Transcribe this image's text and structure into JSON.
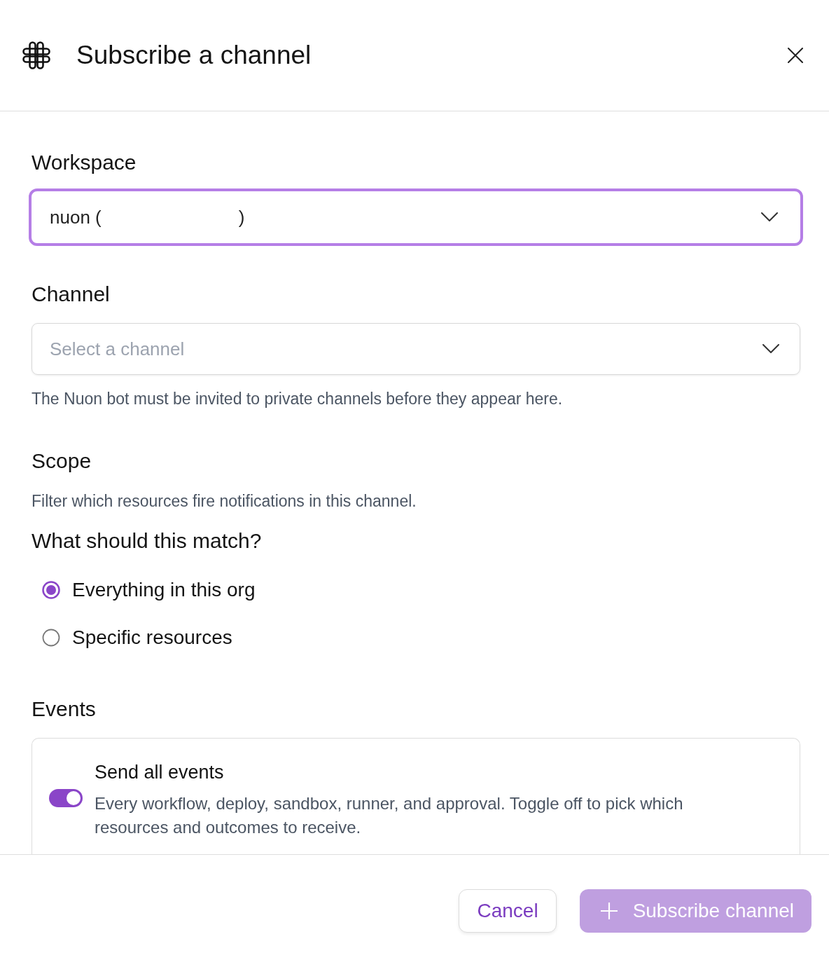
{
  "dialog": {
    "title": "Subscribe a channel"
  },
  "workspace": {
    "label": "Workspace",
    "value_parts": [
      "nuon (",
      ")"
    ],
    "focused": true
  },
  "channel": {
    "label": "Channel",
    "placeholder": "Select a channel",
    "help": "The Nuon bot must be invited to private channels before they appear here."
  },
  "scope": {
    "heading": "Scope",
    "description": "Filter which resources fire notifications in this channel.",
    "question": "What should this match?",
    "options": [
      {
        "label": "Everything in this org",
        "selected": true
      },
      {
        "label": "Specific resources",
        "selected": false
      }
    ]
  },
  "events": {
    "heading": "Events",
    "toggle": {
      "title": "Send all events",
      "description": "Every workflow, deploy, sandbox, runner, and approval. Toggle off to pick which resources and outcomes to receive.",
      "on": true
    }
  },
  "footer": {
    "buttons": [
      {
        "label": "Cancel",
        "kind": "secondary",
        "disabled": false
      },
      {
        "label": "Subscribe channel",
        "kind": "primary",
        "disabled": true
      }
    ]
  }
}
